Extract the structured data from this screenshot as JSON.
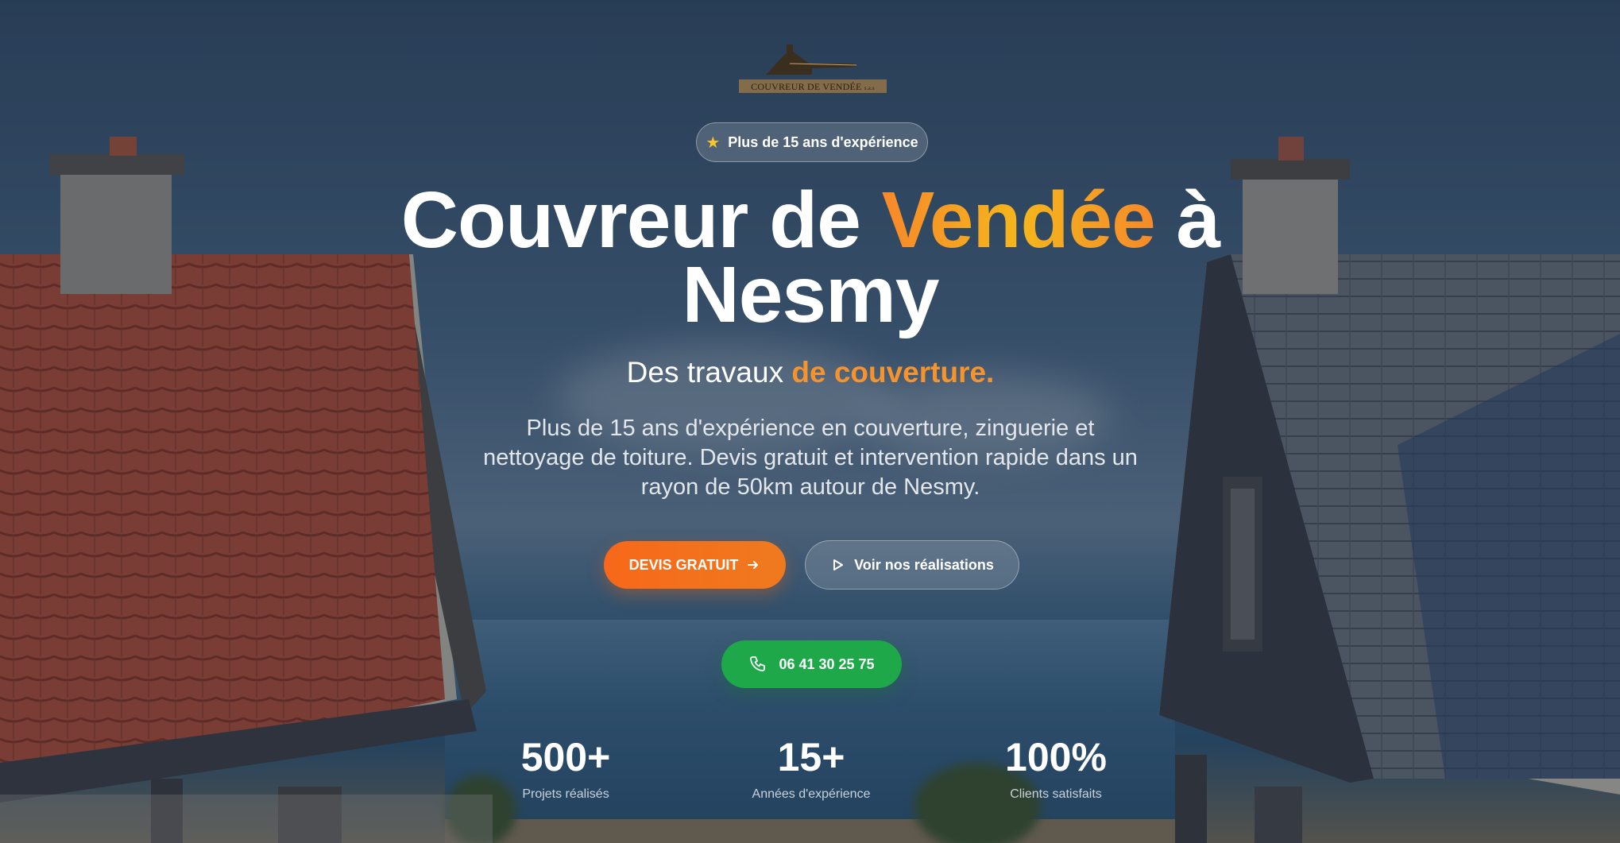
{
  "header": {
    "logo_text": "COUVREUR DE VENDÉE",
    "logo_suffix": "s.a.s"
  },
  "badge": {
    "icon": "star-icon",
    "label": "Plus de 15 ans d'expérience"
  },
  "hero": {
    "title_part1": "Couvreur de ",
    "title_accent": "Vendée",
    "title_part2": " à",
    "title_line2": "Nesmy",
    "subtitle_part1": "Des travaux ",
    "subtitle_accent": "de couverture.",
    "description": "Plus de 15 ans d'expérience en couverture, zinguerie et nettoyage de toiture. Devis gratuit et intervention rapide dans un rayon de 50km autour de Nesmy."
  },
  "buttons": {
    "devis_label": "DEVIS GRATUIT",
    "devis_icon": "arrow-right-icon",
    "realisations_label": "Voir nos réalisations",
    "realisations_icon": "play-icon",
    "phone_label": "06 41 30 25 75",
    "phone_icon": "phone-icon"
  },
  "stats": [
    {
      "value": "500+",
      "label": "Projets réalisés"
    },
    {
      "value": "15+",
      "label": "Années d'expérience"
    },
    {
      "value": "100%",
      "label": "Clients satisfaits"
    }
  ],
  "colors": {
    "accent_orange": "#f7682a",
    "accent_gold": "#f5b61c",
    "phone_green": "#1ea84a",
    "star_yellow": "#f7c72a"
  }
}
